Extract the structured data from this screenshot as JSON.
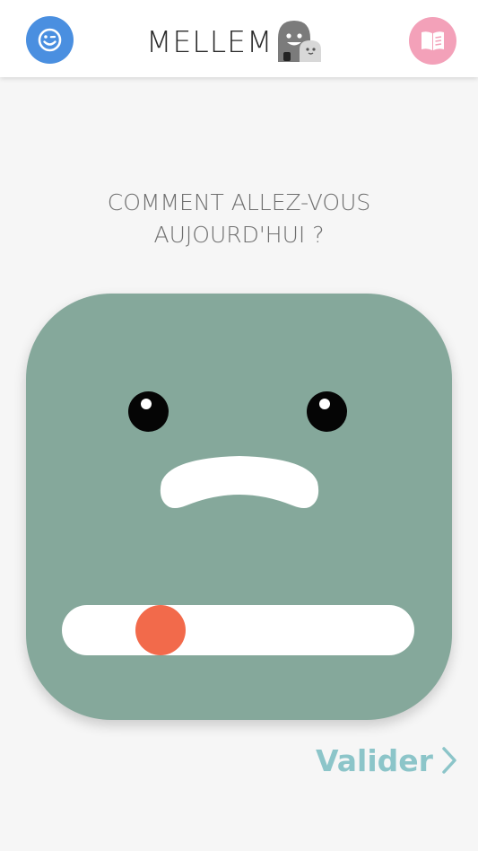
{
  "header": {
    "brand_name": "MELLEM",
    "left_icon": "smiley-face-icon",
    "right_icon": "open-book-icon",
    "left_icon_color": "#4a8fe0",
    "right_icon_color": "#f3a1b9"
  },
  "prompt": {
    "line1": "COMMENT ALLEZ-VOUS",
    "line2": "AUJOURD'HUI ?"
  },
  "mood": {
    "face_color": "#85a89b",
    "mouth": "frown",
    "slider_level": 0.17,
    "slider_thumb_color": "#f26a4b"
  },
  "actions": {
    "validate_label": "Valider",
    "validate_color": "#8cc5c9",
    "validate_icon": "chevron-right-icon"
  }
}
